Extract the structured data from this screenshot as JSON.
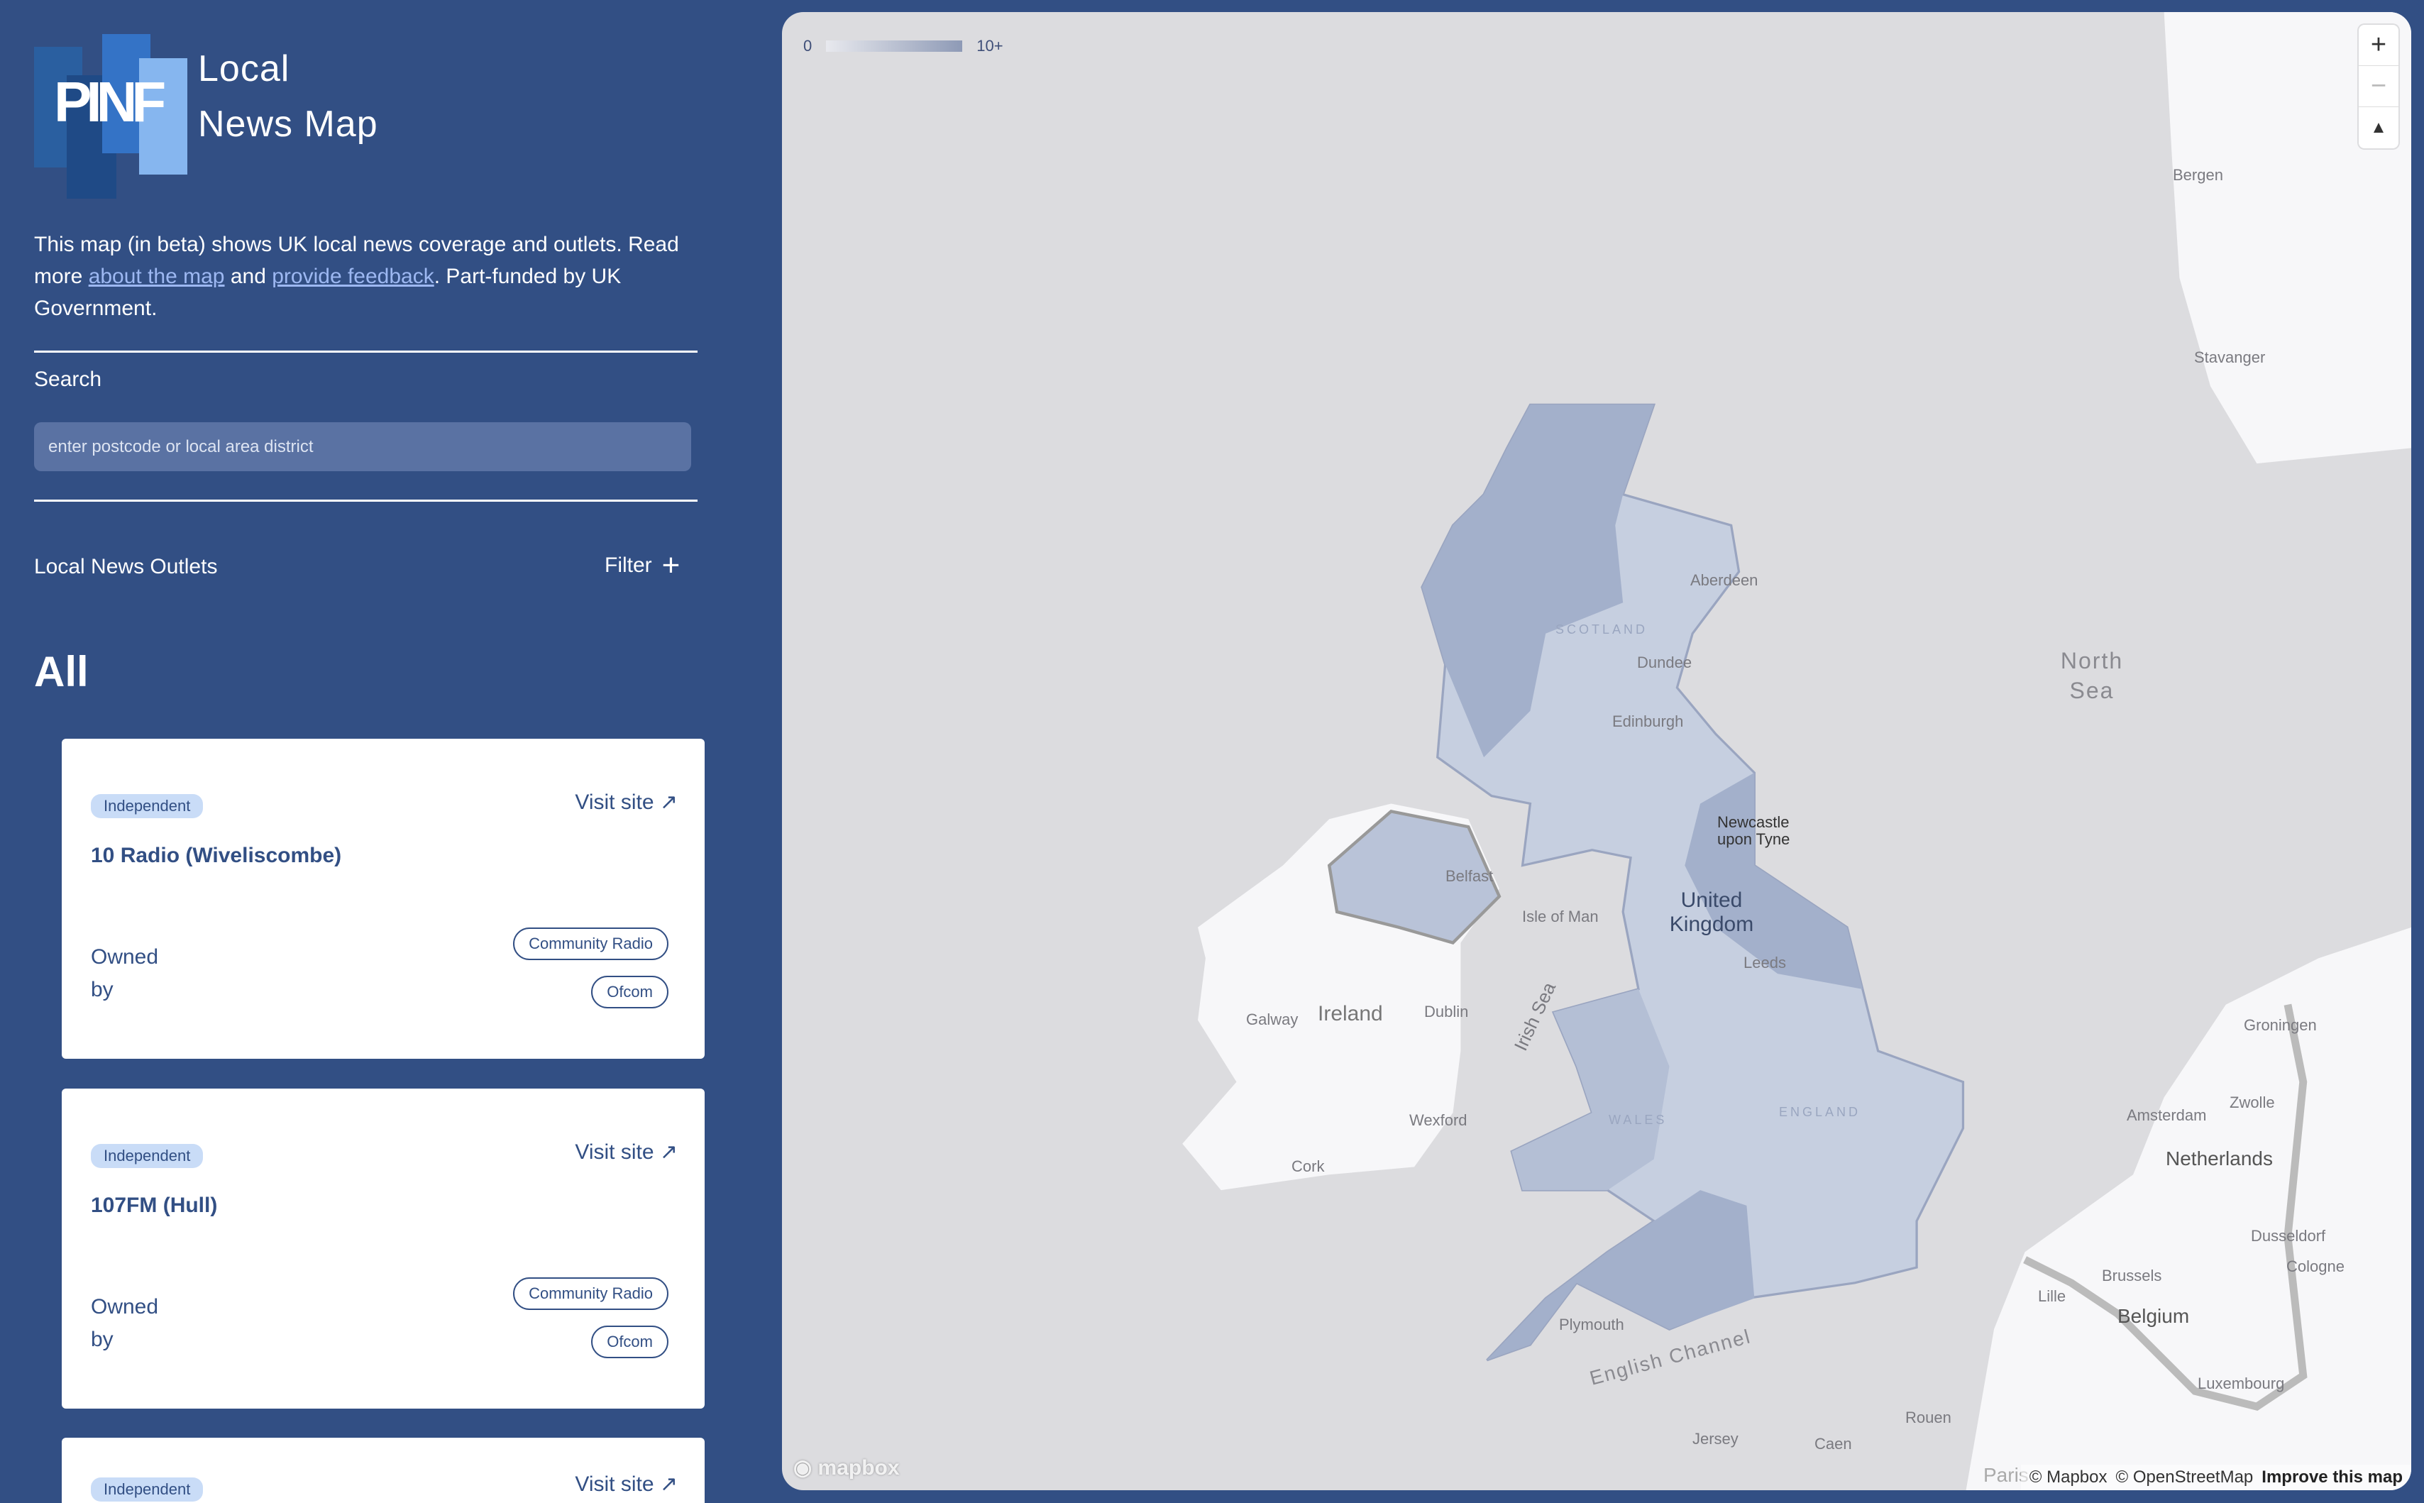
{
  "brand": {
    "logo_text": "PINF",
    "title_line1": "Local",
    "title_line2": "News Map"
  },
  "intro": {
    "text1": "This map (in beta) shows UK local news coverage and outlets. Read more ",
    "link1": "about the map",
    "text2": " and ",
    "link2": "provide feedback",
    "text3": ". Part-funded by UK Government."
  },
  "search": {
    "label": "Search",
    "placeholder": "enter postcode or local area district"
  },
  "outlets": {
    "label": "Local News Outlets",
    "filter_label": "Filter",
    "filter_icon": "plus-icon",
    "heading": "All"
  },
  "cards": [
    {
      "badge": "Independent",
      "visit": "Visit site ↗",
      "title": "10 Radio (Wiveliscombe)",
      "owned": "Owned by",
      "tags": [
        "Community Radio",
        "Ofcom"
      ]
    },
    {
      "badge": "Independent",
      "visit": "Visit site ↗",
      "title": "107FM (Hull)",
      "owned": "Owned by",
      "tags": [
        "Community Radio",
        "Ofcom"
      ]
    },
    {
      "badge": "Independent",
      "visit": "Visit site ↗"
    }
  ],
  "map": {
    "legend": {
      "min": "0",
      "max": "10+"
    },
    "zoom_in": "+",
    "zoom_out": "−",
    "compass": "▲",
    "mapbox_logo": "mapbox",
    "attribution": {
      "mapbox": "© Mapbox",
      "osm": "© OpenStreetMap",
      "improve": "Improve this map"
    },
    "labels": {
      "north_sea": "North Sea",
      "uk": "United Kingdom",
      "ireland": "Ireland",
      "isle_of_man": "Isle of Man",
      "irish_sea": "Irish Sea",
      "dublin": "Dublin",
      "galway": "Galway",
      "cork": "Cork",
      "wexford": "Wexford",
      "english_channel": "English Channel",
      "jersey": "Jersey",
      "caen": "Caen",
      "rouen": "Rouen",
      "paris": "Paris",
      "belgium": "Belgium",
      "brussels": "Brussels",
      "lille": "Lille",
      "netherlands": "Netherlands",
      "amsterdam": "Amsterdam",
      "dusseldorf": "Dusseldorf",
      "cologne": "Cologne",
      "luxembourg": "Luxembourg",
      "groningen": "Groningen",
      "zwolle": "Zwolle",
      "bergen": "Bergen",
      "stavanger": "Stavanger",
      "aberdeen": "Aberdeen",
      "dundee": "Dundee",
      "edinburgh": "Edinburgh",
      "newcastle": "Newcastle upon Tyne",
      "belfast": "Belfast",
      "leeds": "Leeds",
      "plymouth": "Plymouth",
      "scotland": "SCOTLAND",
      "wales": "WALES",
      "england": "ENGLAND"
    }
  }
}
